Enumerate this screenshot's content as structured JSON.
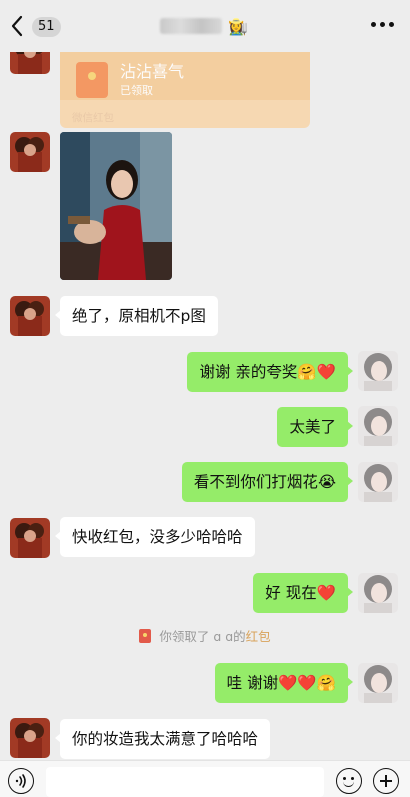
{
  "header": {
    "unread_count": "51",
    "title_emoji": "👩‍🌾"
  },
  "red_packet": {
    "title": "沾沾喜气",
    "status": "已领取",
    "footer": "微信红包"
  },
  "messages": [
    {
      "side": "left",
      "text": "绝了，原相机不p图"
    },
    {
      "side": "right",
      "text": "谢谢 亲的夸奖🤗❤️"
    },
    {
      "side": "right",
      "text": "太美了"
    },
    {
      "side": "right",
      "text": "看不到你们打烟花😭"
    },
    {
      "side": "left",
      "text": "快收红包，没多少哈哈哈"
    },
    {
      "side": "right",
      "text": "好 现在❤️"
    },
    {
      "side": "right",
      "text": "哇 谢谢❤️❤️🤗"
    },
    {
      "side": "left",
      "text": "你的妆造我太满意了哈哈哈"
    }
  ],
  "system_notice": {
    "prefix": "你领取了",
    "name": "ɑ ɑ",
    "mid": "的",
    "link": "红包"
  },
  "colors": {
    "background": "#ededed",
    "bubble_right": "#95ec69",
    "bubble_left": "#ffffff",
    "packet": "#f8d5a8",
    "link": "#d9a35b"
  },
  "icons": [
    "back-arrow-icon",
    "more-icon",
    "voice-icon",
    "emoji-icon",
    "plus-icon",
    "red-packet-icon"
  ]
}
